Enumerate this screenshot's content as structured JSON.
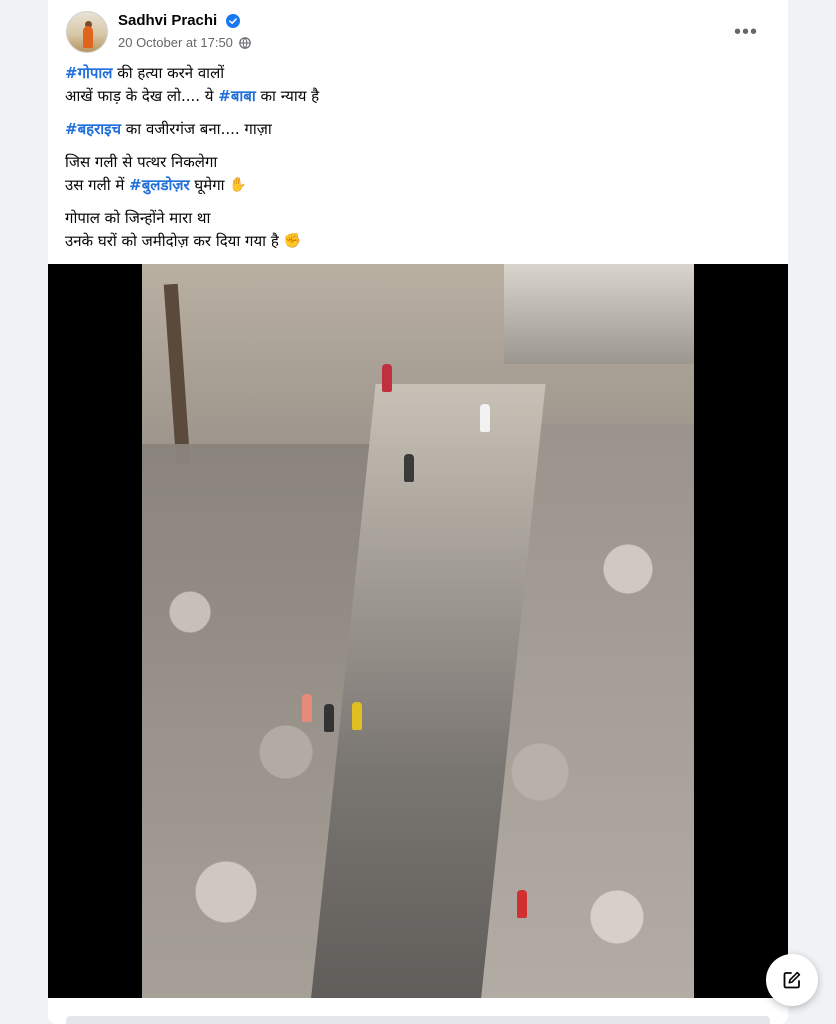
{
  "post": {
    "author": "Sadhvi Prachi",
    "timestamp": "20 October at 17:50",
    "more_options_label": "•••",
    "text": {
      "p1_tag": "#गोपाल",
      "p1_rest": " की हत्या करने वालों",
      "p1_line2_start": "आखें फाड़ के देख लो.... ये ",
      "p1_line2_tag": "#बाबा",
      "p1_line2_end": " का न्याय है",
      "p2_tag": "#बहराइच",
      "p2_rest": " का वजीरगंज बना.... गाज़ा",
      "p3_line1": "जिस गली से पत्थर निकलेगा",
      "p3_line2_start": "उस गली में ",
      "p3_line2_tag": "#बुलडोज़र",
      "p3_line2_end": " घूमेगा ",
      "p3_emoji": "✋",
      "p4_line1": "गोपाल को जिन्होंने मारा था",
      "p4_line2": "उनके घरों को जमीदोज़ कर दिया गया है ",
      "p4_emoji": "✊"
    }
  },
  "colors": {
    "hashtag": "#216fdb",
    "secondary_text": "#65676b",
    "verified": "#1877f2",
    "page_background": "#f0f2f5"
  },
  "icons": {
    "verified": "verified-badge-icon",
    "audience": "globe-icon",
    "more": "more-options-icon",
    "compose": "compose-edit-icon"
  }
}
